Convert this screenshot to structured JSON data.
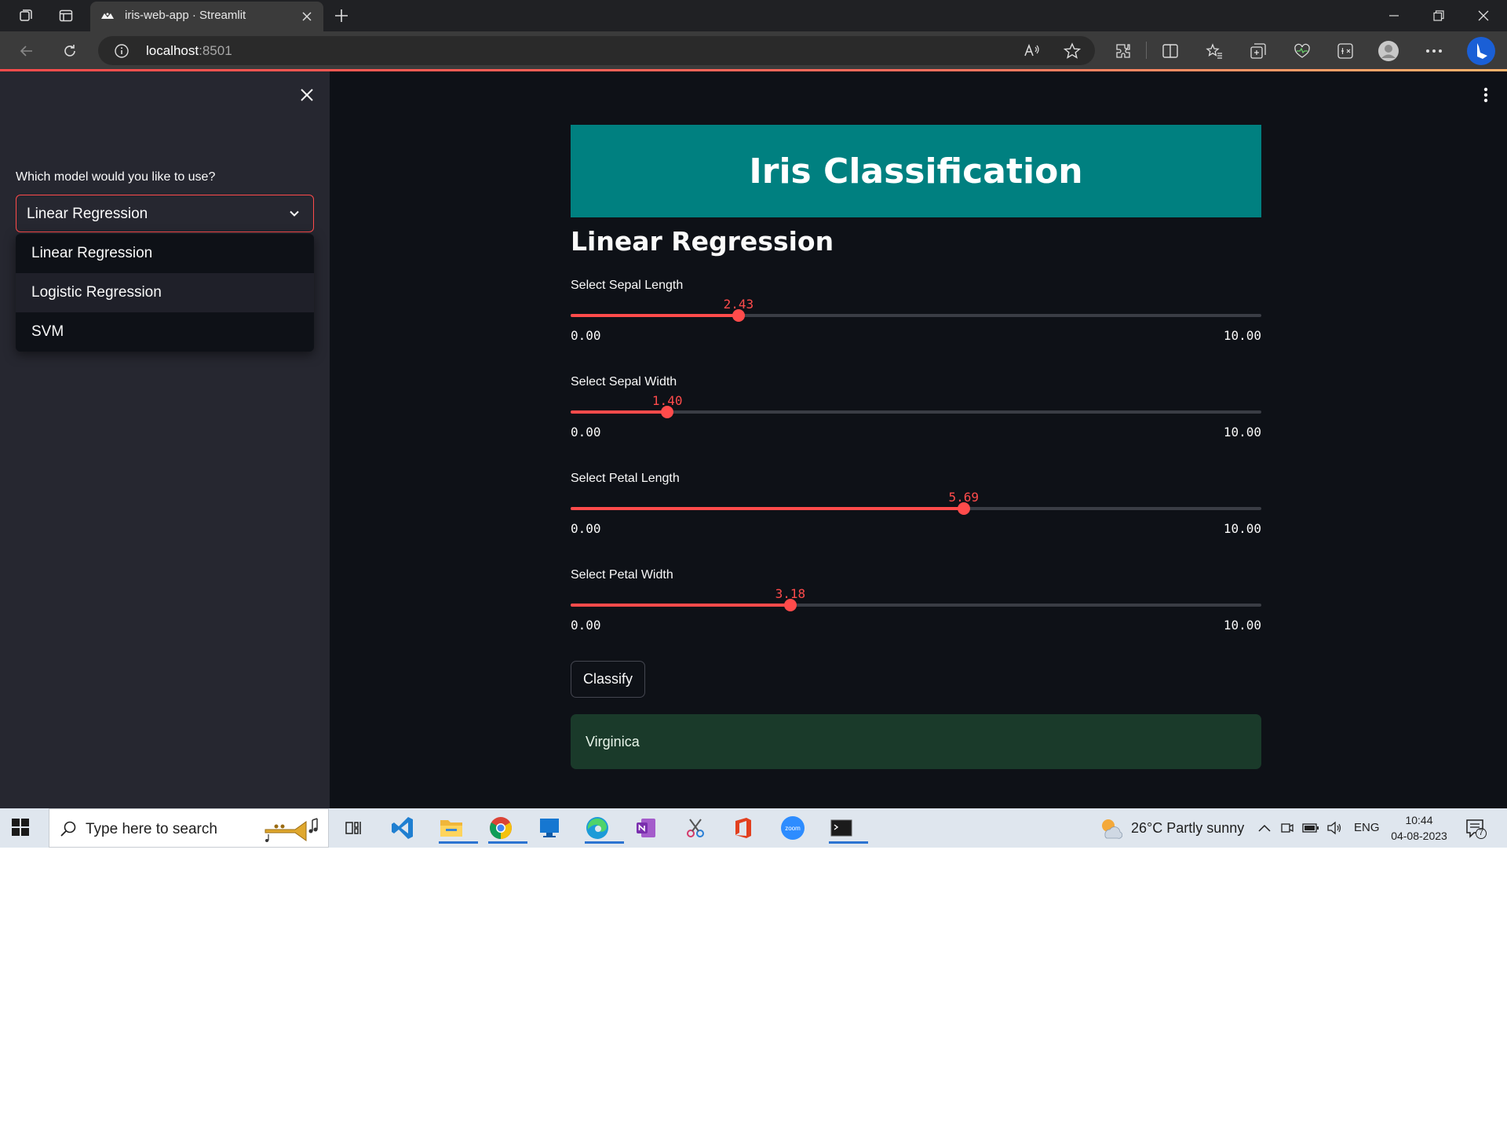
{
  "browser": {
    "tab_title": "iris-web-app · Streamlit",
    "url_host": "localhost",
    "url_port": ":8501"
  },
  "sidebar": {
    "select_label": "Which model would you like to use?",
    "selected_model": "Linear Regression",
    "options": [
      "Linear Regression",
      "Logistic Regression",
      "SVM"
    ]
  },
  "main": {
    "header_title": "Iris Classification",
    "subheader": "Linear Regression",
    "sliders": [
      {
        "label": "Select Sepal Length",
        "value": 2.43,
        "value_text": "2.43",
        "min_text": "0.00",
        "max_text": "10.00",
        "min": 0,
        "max": 10
      },
      {
        "label": "Select Sepal Width",
        "value": 1.4,
        "value_text": "1.40",
        "min_text": "0.00",
        "max_text": "10.00",
        "min": 0,
        "max": 10
      },
      {
        "label": "Select Petal Length",
        "value": 5.69,
        "value_text": "5.69",
        "min_text": "0.00",
        "max_text": "10.00",
        "min": 0,
        "max": 10
      },
      {
        "label": "Select Petal Width",
        "value": 3.18,
        "value_text": "3.18",
        "min_text": "0.00",
        "max_text": "10.00",
        "min": 0,
        "max": 10
      }
    ],
    "classify_label": "Classify",
    "result_text": "Virginica"
  },
  "taskbar": {
    "search_placeholder": "Type here to search",
    "weather": "26°C  Partly sunny",
    "language": "ENG",
    "time": "10:44",
    "date": "04-08-2023",
    "notification_count": "7",
    "apps": [
      "task-view",
      "vscode",
      "file-explorer",
      "chrome",
      "windows-app",
      "edge",
      "onenote",
      "snipping-tool",
      "office",
      "zoom",
      "terminal"
    ]
  },
  "colors": {
    "accent": "#ff4b4b",
    "header_bg": "#008080",
    "result_bg": "#1a3a2a",
    "main_bg": "#0e1117",
    "sidebar_bg": "#262730"
  }
}
